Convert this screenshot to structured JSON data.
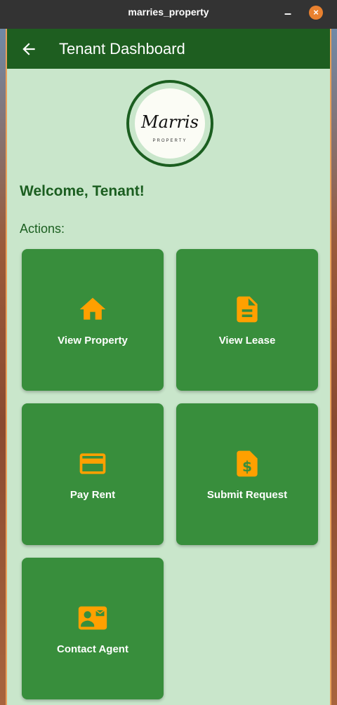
{
  "window": {
    "title": "marries_property",
    "minimize_symbol": "–",
    "close_symbol": "×",
    "close_color": "#e9812f"
  },
  "appbar": {
    "title": "Tenant Dashboard",
    "back_icon": "arrow-left-icon",
    "color": "#1e5e20"
  },
  "logo": {
    "text": "Marris",
    "subtitle": "PROPERTY"
  },
  "welcome": "Welcome, Tenant!",
  "actions_label": "Actions:",
  "actions": [
    {
      "label": "View Property",
      "icon": "home-icon"
    },
    {
      "label": "View Lease",
      "icon": "document-icon"
    },
    {
      "label": "Pay Rent",
      "icon": "credit-card-icon"
    },
    {
      "label": "Submit Request",
      "icon": "dollar-document-icon"
    },
    {
      "label": "Contact Agent",
      "icon": "contact-mail-icon"
    }
  ],
  "colors": {
    "card": "#388e3c",
    "icon": "#ffa000",
    "background": "#c9e6cb",
    "text_green": "#1b5e20"
  }
}
